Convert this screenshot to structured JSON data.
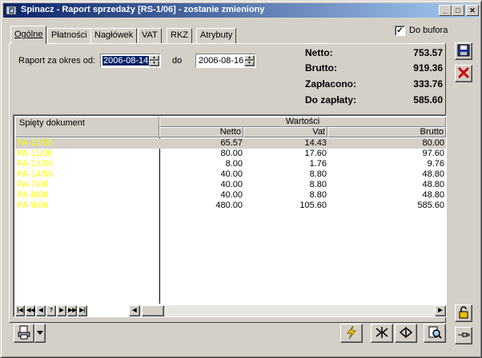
{
  "window": {
    "title": "Spinacz - Raport sprzedaży [RS-1/06] - zostanie zmieniony",
    "controls": {
      "minimize": "_",
      "maximize": "□",
      "close": "✕"
    }
  },
  "tabs": [
    {
      "label": "Ogólne",
      "active": true
    },
    {
      "label": "Płatności",
      "active": false
    },
    {
      "label": "Nagłówek",
      "active": false
    },
    {
      "label": "VAT",
      "active": false
    },
    {
      "label": "RKZ",
      "active": false
    },
    {
      "label": "Atrybuty",
      "active": false
    }
  ],
  "buffer": {
    "label": "Do bufora",
    "checked": true,
    "check_mark": "✓"
  },
  "period": {
    "label": "Raport za okres od:",
    "from": "2006-08-14",
    "to_label": "do",
    "to": "2006-08-16"
  },
  "totals": [
    {
      "label": "Netto:",
      "value": "753.57"
    },
    {
      "label": "Brutto:",
      "value": "919.36"
    },
    {
      "label": "Zapłacono:",
      "value": "333.76"
    },
    {
      "label": "Do zapłaty:",
      "value": "585.60"
    }
  ],
  "grid": {
    "col_document": "Spięty dokument",
    "group_values": "Wartości",
    "col_netto": "Netto",
    "col_vat": "Vat",
    "col_brutto": "Brutto",
    "rows": [
      {
        "doc": "PA-10/06",
        "netto": "65.57",
        "vat": "14.43",
        "brutto": "80.00"
      },
      {
        "doc": "PA-11/06",
        "netto": "80.00",
        "vat": "17.60",
        "brutto": "97.60"
      },
      {
        "doc": "PA-13/06",
        "netto": "8.00",
        "vat": "1.76",
        "brutto": "9.76"
      },
      {
        "doc": "PA-14/06",
        "netto": "40.00",
        "vat": "8.80",
        "brutto": "48.80"
      },
      {
        "doc": "PA-7/06",
        "netto": "40.00",
        "vat": "8.80",
        "brutto": "48.80"
      },
      {
        "doc": "PA-8/06",
        "netto": "40.00",
        "vat": "8.80",
        "brutto": "48.80"
      },
      {
        "doc": "PA-9/06",
        "netto": "480.00",
        "vat": "105.60",
        "brutto": "585.60"
      }
    ],
    "nav": [
      "|◀",
      "◀◀",
      "◀",
      "?",
      "▶",
      "▶▶",
      "▶|"
    ],
    "scroll_left": "◀",
    "scroll_right": "▶"
  },
  "colors": {
    "titlebar_start": "#0a246a",
    "titlebar_end": "#a6caf0",
    "document_text": "#ffff00",
    "face": "#d4d0c8"
  },
  "icons": {
    "app": "paperclip-icon",
    "save": "floppy-disk-icon",
    "cancel": "red-x-icon",
    "lock": "padlock-icon",
    "pin": "pin-icon",
    "print": "printer-icon",
    "lightning": "lightning-icon",
    "join": "merge-icon",
    "split": "split-icon",
    "preview": "magnifier-icon"
  }
}
